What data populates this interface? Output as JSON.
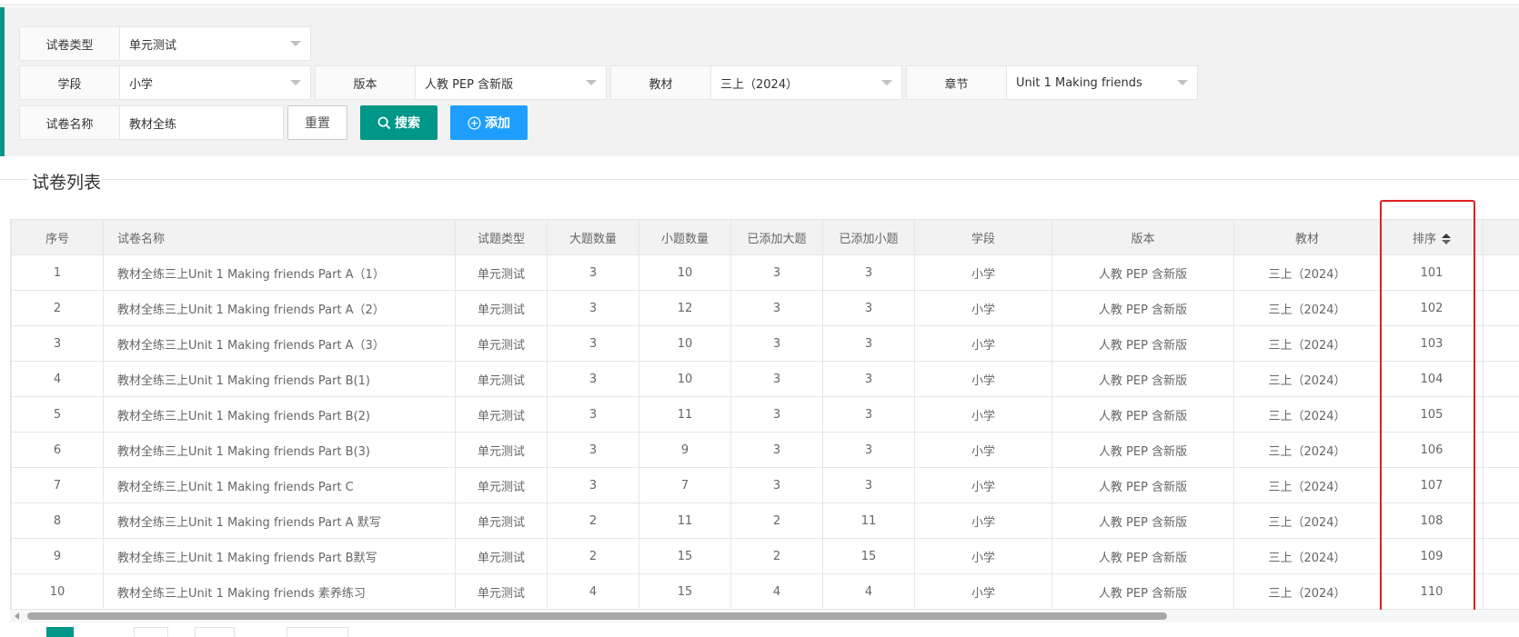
{
  "filters": {
    "type": {
      "label": "试卷类型",
      "value": "单元测试"
    },
    "stage": {
      "label": "学段",
      "value": "小学"
    },
    "edition": {
      "label": "版本",
      "value": "人教 PEP 含新版"
    },
    "textbook": {
      "label": "教材",
      "value": "三上（2024）"
    },
    "chapter": {
      "label": "章节",
      "value": "Unit 1 Making friends"
    },
    "name": {
      "label": "试卷名称",
      "value": "教材全练"
    }
  },
  "buttons": {
    "reset": "重置",
    "search": "搜索",
    "add": "添加"
  },
  "section_title": "试卷列表",
  "table": {
    "columns": [
      "序号",
      "试卷名称",
      "试题类型",
      "大题数量",
      "小题数量",
      "已添加大题",
      "已添加小题",
      "学段",
      "版本",
      "教材",
      "排序"
    ],
    "rows": [
      [
        "1",
        "教材全练三上Unit 1 Making friends Part A（1）",
        "单元测试",
        "3",
        "10",
        "3",
        "3",
        "小学",
        "人教 PEP 含新版",
        "三上（2024）",
        "101"
      ],
      [
        "2",
        "教材全练三上Unit 1 Making friends Part A（2）",
        "单元测试",
        "3",
        "12",
        "3",
        "3",
        "小学",
        "人教 PEP 含新版",
        "三上（2024）",
        "102"
      ],
      [
        "3",
        "教材全练三上Unit 1 Making friends Part A（3）",
        "单元测试",
        "3",
        "10",
        "3",
        "3",
        "小学",
        "人教 PEP 含新版",
        "三上（2024）",
        "103"
      ],
      [
        "4",
        "教材全练三上Unit 1 Making friends Part B(1)",
        "单元测试",
        "3",
        "10",
        "3",
        "3",
        "小学",
        "人教 PEP 含新版",
        "三上（2024）",
        "104"
      ],
      [
        "5",
        "教材全练三上Unit 1 Making friends Part B(2)",
        "单元测试",
        "3",
        "11",
        "3",
        "3",
        "小学",
        "人教 PEP 含新版",
        "三上（2024）",
        "105"
      ],
      [
        "6",
        "教材全练三上Unit 1 Making friends Part B(3)",
        "单元测试",
        "3",
        "9",
        "3",
        "3",
        "小学",
        "人教 PEP 含新版",
        "三上（2024）",
        "106"
      ],
      [
        "7",
        "教材全练三上Unit 1 Making friends Part C",
        "单元测试",
        "3",
        "7",
        "3",
        "3",
        "小学",
        "人教 PEP 含新版",
        "三上（2024）",
        "107"
      ],
      [
        "8",
        "教材全练三上Unit 1 Making friends Part A 默写",
        "单元测试",
        "2",
        "11",
        "2",
        "11",
        "小学",
        "人教 PEP 含新版",
        "三上（2024）",
        "108"
      ],
      [
        "9",
        "教材全练三上Unit 1 Making friends Part B默写",
        "单元测试",
        "2",
        "15",
        "2",
        "15",
        "小学",
        "人教 PEP 含新版",
        "三上（2024）",
        "109"
      ],
      [
        "10",
        "教材全练三上Unit 1 Making friends 素养练习",
        "单元测试",
        "4",
        "15",
        "4",
        "4",
        "小学",
        "人教 PEP 含新版",
        "三上（2024）",
        "110"
      ]
    ]
  },
  "colors": {
    "primary": "#009688",
    "blue": "#1e9fff",
    "highlight": "#e02020"
  },
  "icons": {
    "search": "search-icon",
    "add": "plus-circle-icon",
    "sort": "sort-icon"
  }
}
